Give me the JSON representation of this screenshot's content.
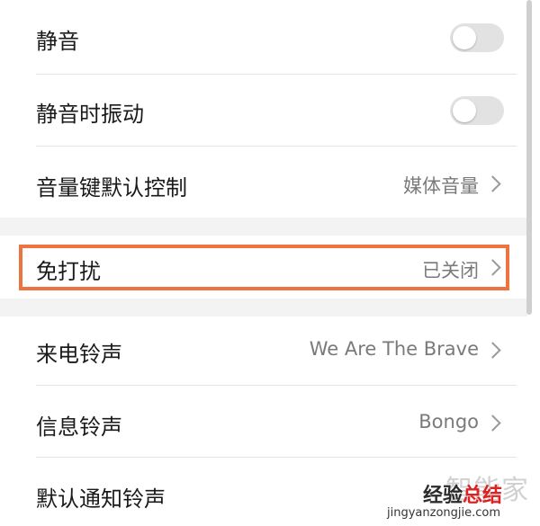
{
  "settings": {
    "mute": {
      "label": "静音",
      "enabled": false
    },
    "vibrate_on_mute": {
      "label": "静音时振动",
      "enabled": false
    },
    "volume_key": {
      "label": "音量键默认控制",
      "value": "媒体音量"
    },
    "dnd": {
      "label": "免打扰",
      "value": "已关闭"
    },
    "ringtone": {
      "label": "来电铃声",
      "value": "We Are The Brave"
    },
    "message_tone": {
      "label": "信息铃声",
      "value": "Bongo"
    },
    "notification_tone": {
      "label": "默认通知铃声"
    }
  },
  "highlight_color": "#ed7440",
  "watermark": {
    "brand_faint": "智能家",
    "brand_main_a": "经验",
    "brand_main_b": "总结",
    "url": "jingyanzongjie.com"
  }
}
